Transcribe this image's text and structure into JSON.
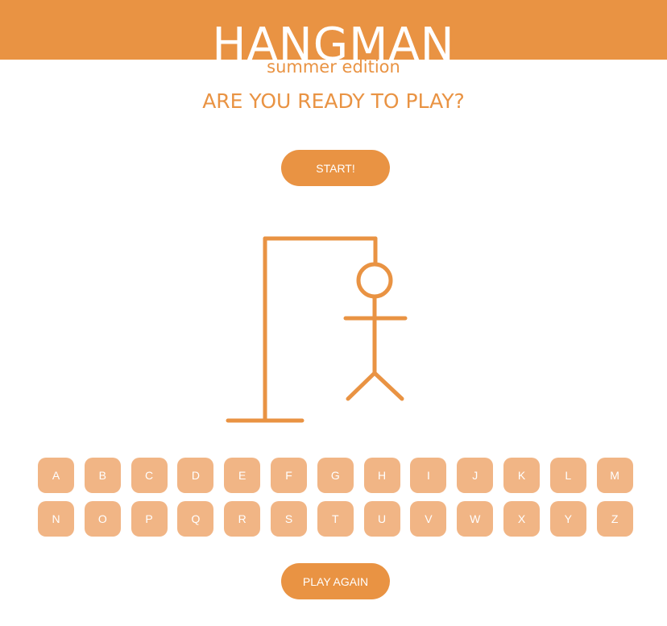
{
  "header": {
    "title": "HANGMAN",
    "subtitle": "summer edition"
  },
  "prompt": "ARE YOU READY TO PLAY?",
  "start_button": "START!",
  "play_again_button": "PLAY AGAIN",
  "keyboard": {
    "row_1": [
      "A",
      "B",
      "C",
      "D",
      "E",
      "F",
      "G",
      "H",
      "I",
      "J",
      "K",
      "L",
      "M"
    ],
    "row_2": [
      "N",
      "O",
      "P",
      "Q",
      "R",
      "S",
      "T",
      "U",
      "V",
      "W",
      "X",
      "Y",
      "Z"
    ]
  },
  "hangman_figure": {
    "parts_drawn": [
      "base",
      "pole",
      "beam",
      "rope",
      "head",
      "body",
      "arms",
      "left-leg",
      "right-leg"
    ]
  },
  "colors": {
    "accent": "#e99343",
    "key_background": "#f1b585",
    "key_text": "#ffffff"
  }
}
